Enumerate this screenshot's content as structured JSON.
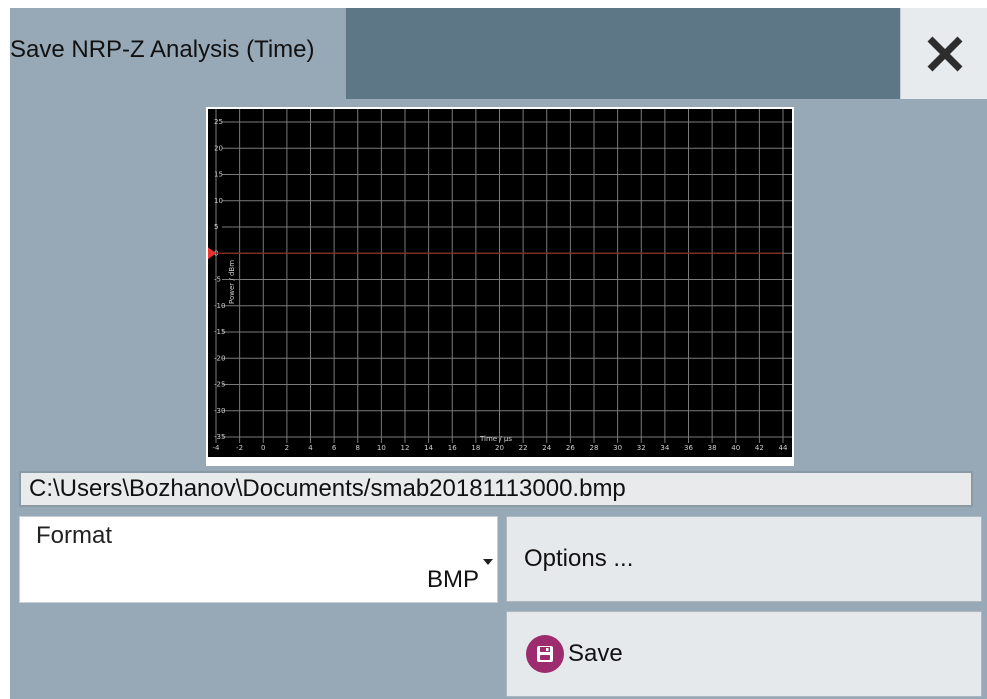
{
  "dialog": {
    "title": "Save NRP-Z Analysis (Time)",
    "close_icon": "close-icon"
  },
  "chart_data": {
    "type": "line",
    "xlabel": "Time / µs",
    "ylabel": "Power / dBm",
    "xlim": [
      -4,
      44
    ],
    "ylim": [
      -35,
      25
    ],
    "x_ticks": [
      -4,
      -2,
      0,
      2,
      4,
      6,
      8,
      10,
      12,
      14,
      16,
      18,
      20,
      22,
      24,
      26,
      28,
      30,
      32,
      34,
      36,
      38,
      40,
      42,
      44
    ],
    "y_ticks": [
      25,
      20,
      15,
      10,
      5,
      0,
      -5,
      -10,
      -15,
      -20,
      -25,
      -30,
      -35
    ],
    "grid": true,
    "background": "#000000",
    "grid_color": "#7a7a7a",
    "reference_marker": {
      "y": 0,
      "color": "#e8322e"
    },
    "series": [
      {
        "x": [
          -4,
          44
        ],
        "y": [
          0,
          0
        ],
        "color": "#8b2a24"
      }
    ]
  },
  "file": {
    "path": "C:\\Users\\Bozhanov\\Documents/smab20181113000.bmp"
  },
  "format": {
    "label": "Format",
    "value": "BMP"
  },
  "buttons": {
    "options_label": "Options ...",
    "save_label": "Save",
    "save_icon": "save-icon",
    "save_icon_color": "#9c2c6e"
  }
}
